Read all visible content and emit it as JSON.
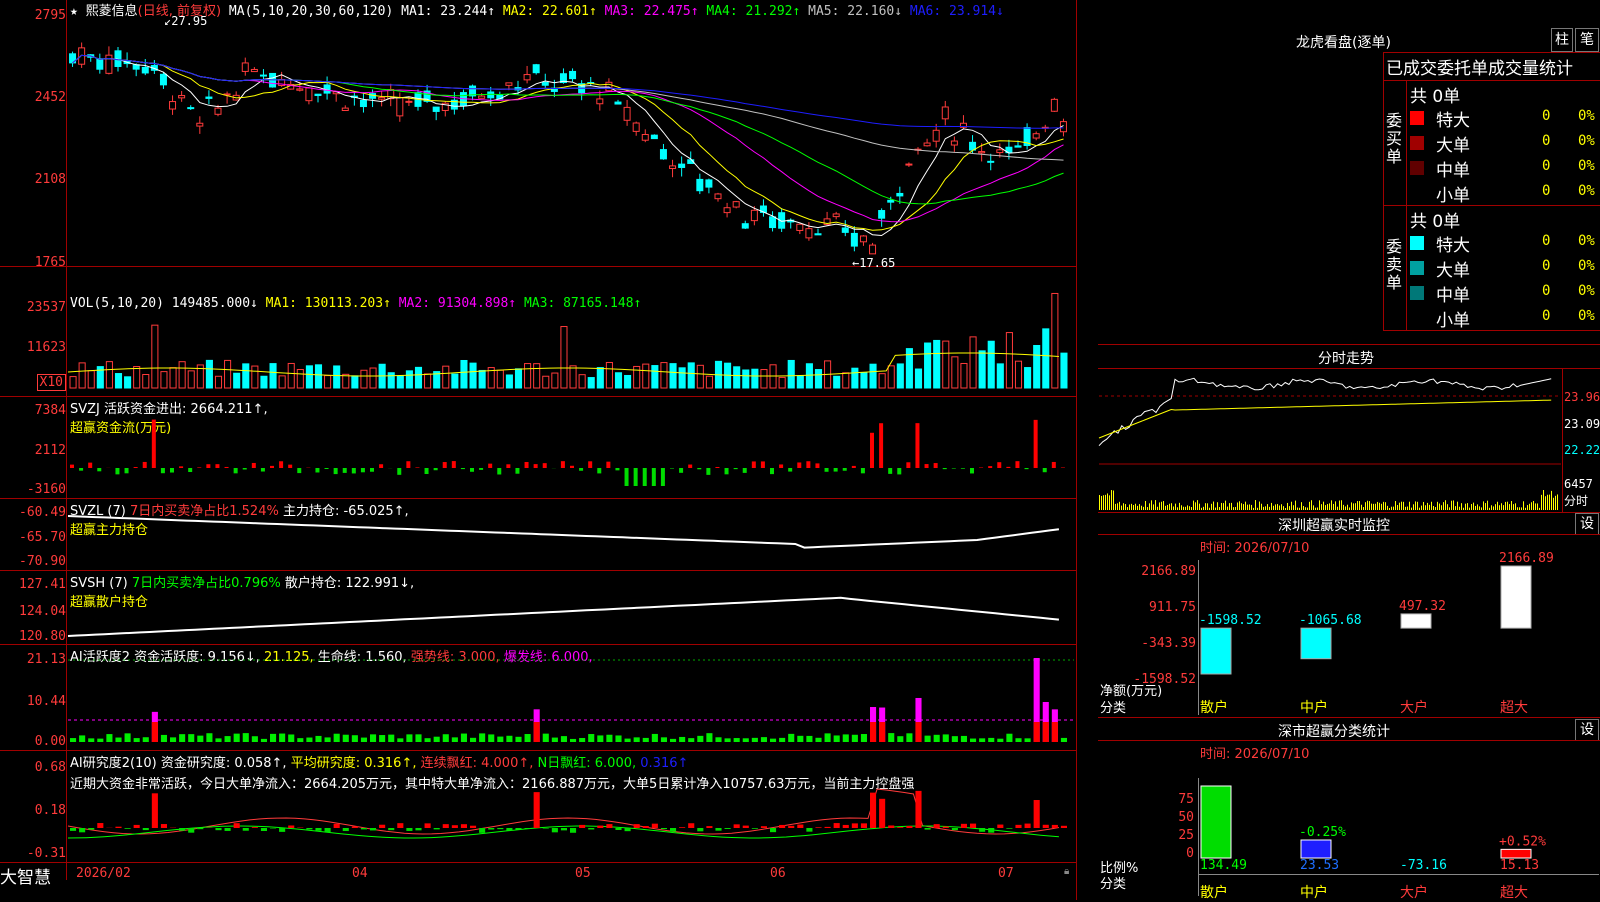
{
  "main_chart": {
    "star": "★",
    "stock_name": "熙菱信息",
    "period_label": "(日线, 前复权)",
    "ma_prefix": "MA(5,10,20,30,60,120)",
    "ma_items": [
      {
        "text": "MA1: 23.244↑",
        "color": "#ffffff"
      },
      {
        "text": "MA2: 22.601↑",
        "color": "#ffff00"
      },
      {
        "text": "MA3: 22.475↑",
        "color": "#ff00ff"
      },
      {
        "text": "MA4: 21.292↑",
        "color": "#00ff00"
      },
      {
        "text": "MA5: 22.160↓",
        "color": "#c0c0c0"
      },
      {
        "text": "MA6: 23.914↓",
        "color": "#1e1eff"
      }
    ],
    "y_labels": [
      "2795",
      "2452",
      "2108",
      "1765"
    ],
    "high_marker": "27.95",
    "low_marker": "←17.65"
  },
  "volume": {
    "header": "VOL(5,10,20)",
    "value": "149485.000↓",
    "items": [
      {
        "text": "MA1: 130113.203↑",
        "color": "#ffff00"
      },
      {
        "text": "MA2: 91304.898↑",
        "color": "#ff00ff"
      },
      {
        "text": "MA3: 87165.148↑",
        "color": "#00ff00"
      }
    ],
    "y_labels": [
      "23537",
      "11623"
    ],
    "unit": "X10"
  },
  "svzj": {
    "line1": "SVZJ  活跃资金进出: 2664.211↑,",
    "line2": "超赢资金流(万元)",
    "y_labels": [
      "7384",
      "2112",
      "-3160"
    ]
  },
  "svzl": {
    "prefix": "SVZL (7)",
    "mid": "7日内买卖净占比1.524%",
    "tail": "主力持仓: -65.025↑,",
    "line2": "超赢主力持仓",
    "y_labels": [
      "-60.49",
      "-65.70",
      "-70.90"
    ]
  },
  "svsh": {
    "prefix": "SVSH (7)",
    "mid": "7日内买卖净占比0.796%",
    "tail": "散户持仓: 122.991↓,",
    "line2": "超赢散户持仓",
    "y_labels": [
      "127.41",
      "124.04",
      "120.80"
    ]
  },
  "ai_active": {
    "prefix": "AI活跃度2 资金活跃度: 9.156↓,",
    "v2": "21.125,",
    "v3": "生命线: 1.560,",
    "v4": "强势线: 3.000,",
    "v5": "爆发线: 6.000,",
    "y_labels": [
      "21.13",
      "10.44",
      "0.00"
    ]
  },
  "ai_research": {
    "prefix": "AI研究度2(10) 资金研究度: 0.058↑,",
    "v2": "平均研究度: 0.316↑,",
    "v3": "连续飘红: 4.000↑,",
    "v4": "N日飘红: 6.000,",
    "v5": "0.316↑",
    "summary": "近期大资金非常活跃，今日大单净流入：2664.205万元，其中特大单净流入：2166.887万元，大单5日累计净入10757.63万元，当前主力控盘强",
    "y_labels": [
      "0.68",
      "0.18",
      "-0.31"
    ]
  },
  "x_axis": {
    "brand": "大智慧",
    "labels": [
      "2026/02",
      "04",
      "05",
      "06",
      "07"
    ]
  },
  "right_panel": {
    "dragon_title": "龙虎看盘(逐单)",
    "btn_zhu": "柱",
    "btn_bi": "笔",
    "stats_title": "已成交委托单成交量统计",
    "buy": {
      "side_label": "委买单",
      "total": "共 0单",
      "rows": [
        {
          "name": "特大",
          "count": "0",
          "pct": "0%",
          "color": "#ff0000"
        },
        {
          "name": "大单",
          "count": "0",
          "pct": "0%",
          "color": "#a00000"
        },
        {
          "name": "中单",
          "count": "0",
          "pct": "0%",
          "color": "#600000"
        },
        {
          "name": "小单",
          "count": "0",
          "pct": "0%",
          "color": "#000000"
        }
      ]
    },
    "sell": {
      "side_label": "委卖单",
      "total": "共 0单",
      "rows": [
        {
          "name": "特大",
          "count": "0",
          "pct": "0%",
          "color": "#00ffff"
        },
        {
          "name": "大单",
          "count": "0",
          "pct": "0%",
          "color": "#00a0a0"
        },
        {
          "name": "中单",
          "count": "0",
          "pct": "0%",
          "color": "#007878"
        },
        {
          "name": "小单",
          "count": "0",
          "pct": "0%",
          "color": "#000000"
        }
      ]
    },
    "intraday": {
      "title": "分时走势",
      "price_labels": [
        "23.96",
        "23.09",
        "22.22"
      ],
      "vol_label": "6457",
      "vol_unit": "分时"
    },
    "monitor": {
      "title": "深圳超赢实时监控",
      "settings": "设",
      "date": "时间: 2026/07/10",
      "y_labels": [
        "2166.89",
        "911.75",
        "-343.39",
        "-1598.52"
      ],
      "axis_label": "净额(万元)",
      "cat_label": "分类",
      "categories": [
        "散户",
        "中户",
        "大户",
        "超大"
      ],
      "values": [
        -1598.52,
        -1065.68,
        497.32,
        2166.89
      ],
      "value_labels": [
        "-1598.52",
        "-1065.68",
        "497.32",
        "2166.89"
      ]
    },
    "classify": {
      "title": "深市超赢分类统计",
      "settings": "设",
      "date": "时间: 2026/07/10",
      "y_labels": [
        "75",
        "50",
        "25",
        "0"
      ],
      "axis_label": "比例%",
      "cat_label": "分类",
      "categories": [
        "散户",
        "中户",
        "大户",
        "超大"
      ],
      "pct_labels": [
        "",
        "-0.25%",
        "",
        "+0.52%"
      ],
      "bar_values": [
        100,
        25,
        0,
        12
      ],
      "bottom_values": [
        "134.49",
        "23.53",
        "-73.16",
        "15.13"
      ]
    }
  }
}
